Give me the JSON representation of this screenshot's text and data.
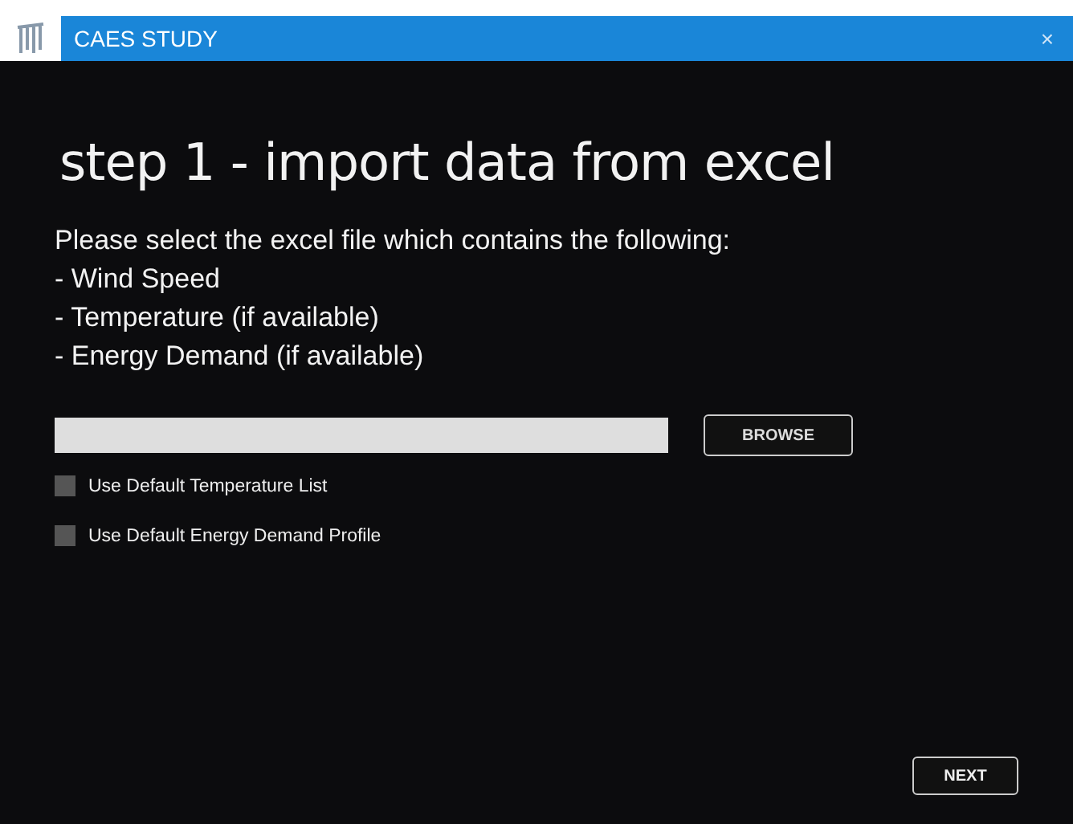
{
  "window": {
    "title": "CAES STUDY",
    "close": "×"
  },
  "heading": "step 1 - import data from excel",
  "instructions": [
    "Please select the excel file which contains the following:",
    "- Wind Speed",
    "- Temperature (if available)",
    "- Energy Demand (if available)"
  ],
  "file_field": {
    "button": "BROWSE"
  },
  "options": [
    {
      "label": "Use Default Temperature List",
      "checked": false
    },
    {
      "label": "Use Default Energy Demand Profile",
      "checked": false
    }
  ],
  "next_button": "NEXT"
}
